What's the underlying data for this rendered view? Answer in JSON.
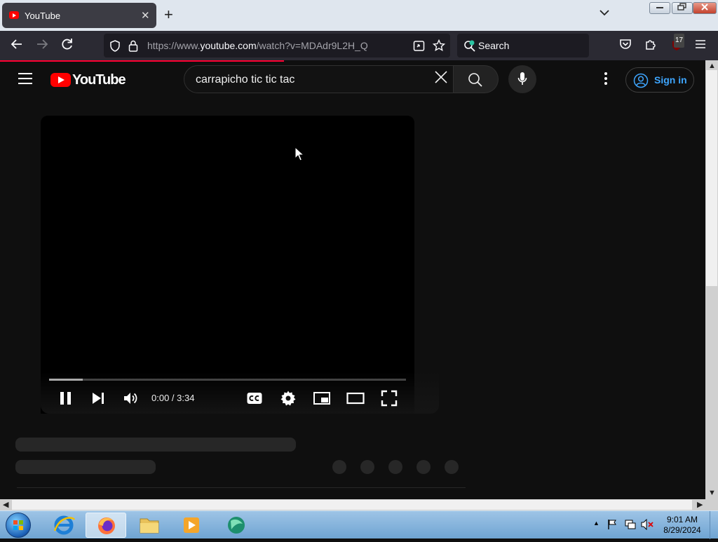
{
  "browser": {
    "tab_title": "YouTube",
    "url_prefix": "https://www.",
    "url_domain": "youtube.com",
    "url_path": "/watch?v=MDAdr9L2H_Q",
    "search_placeholder": "Search",
    "extension_badge": "17"
  },
  "youtube": {
    "logo_text": "YouTube",
    "search_query": "carrapicho tic tic tac",
    "sign_in_label": "Sign in"
  },
  "player": {
    "time_current": "0:00",
    "time_separator": " / ",
    "time_total": "3:34",
    "progress_buffered_fraction": 0.095
  },
  "taskbar": {
    "time": "9:01 AM",
    "date": "8/29/2024"
  },
  "colors": {
    "youtube_red": "#ff0000",
    "link_blue": "#3ea6ff",
    "loading_bar": "#ff0033"
  }
}
